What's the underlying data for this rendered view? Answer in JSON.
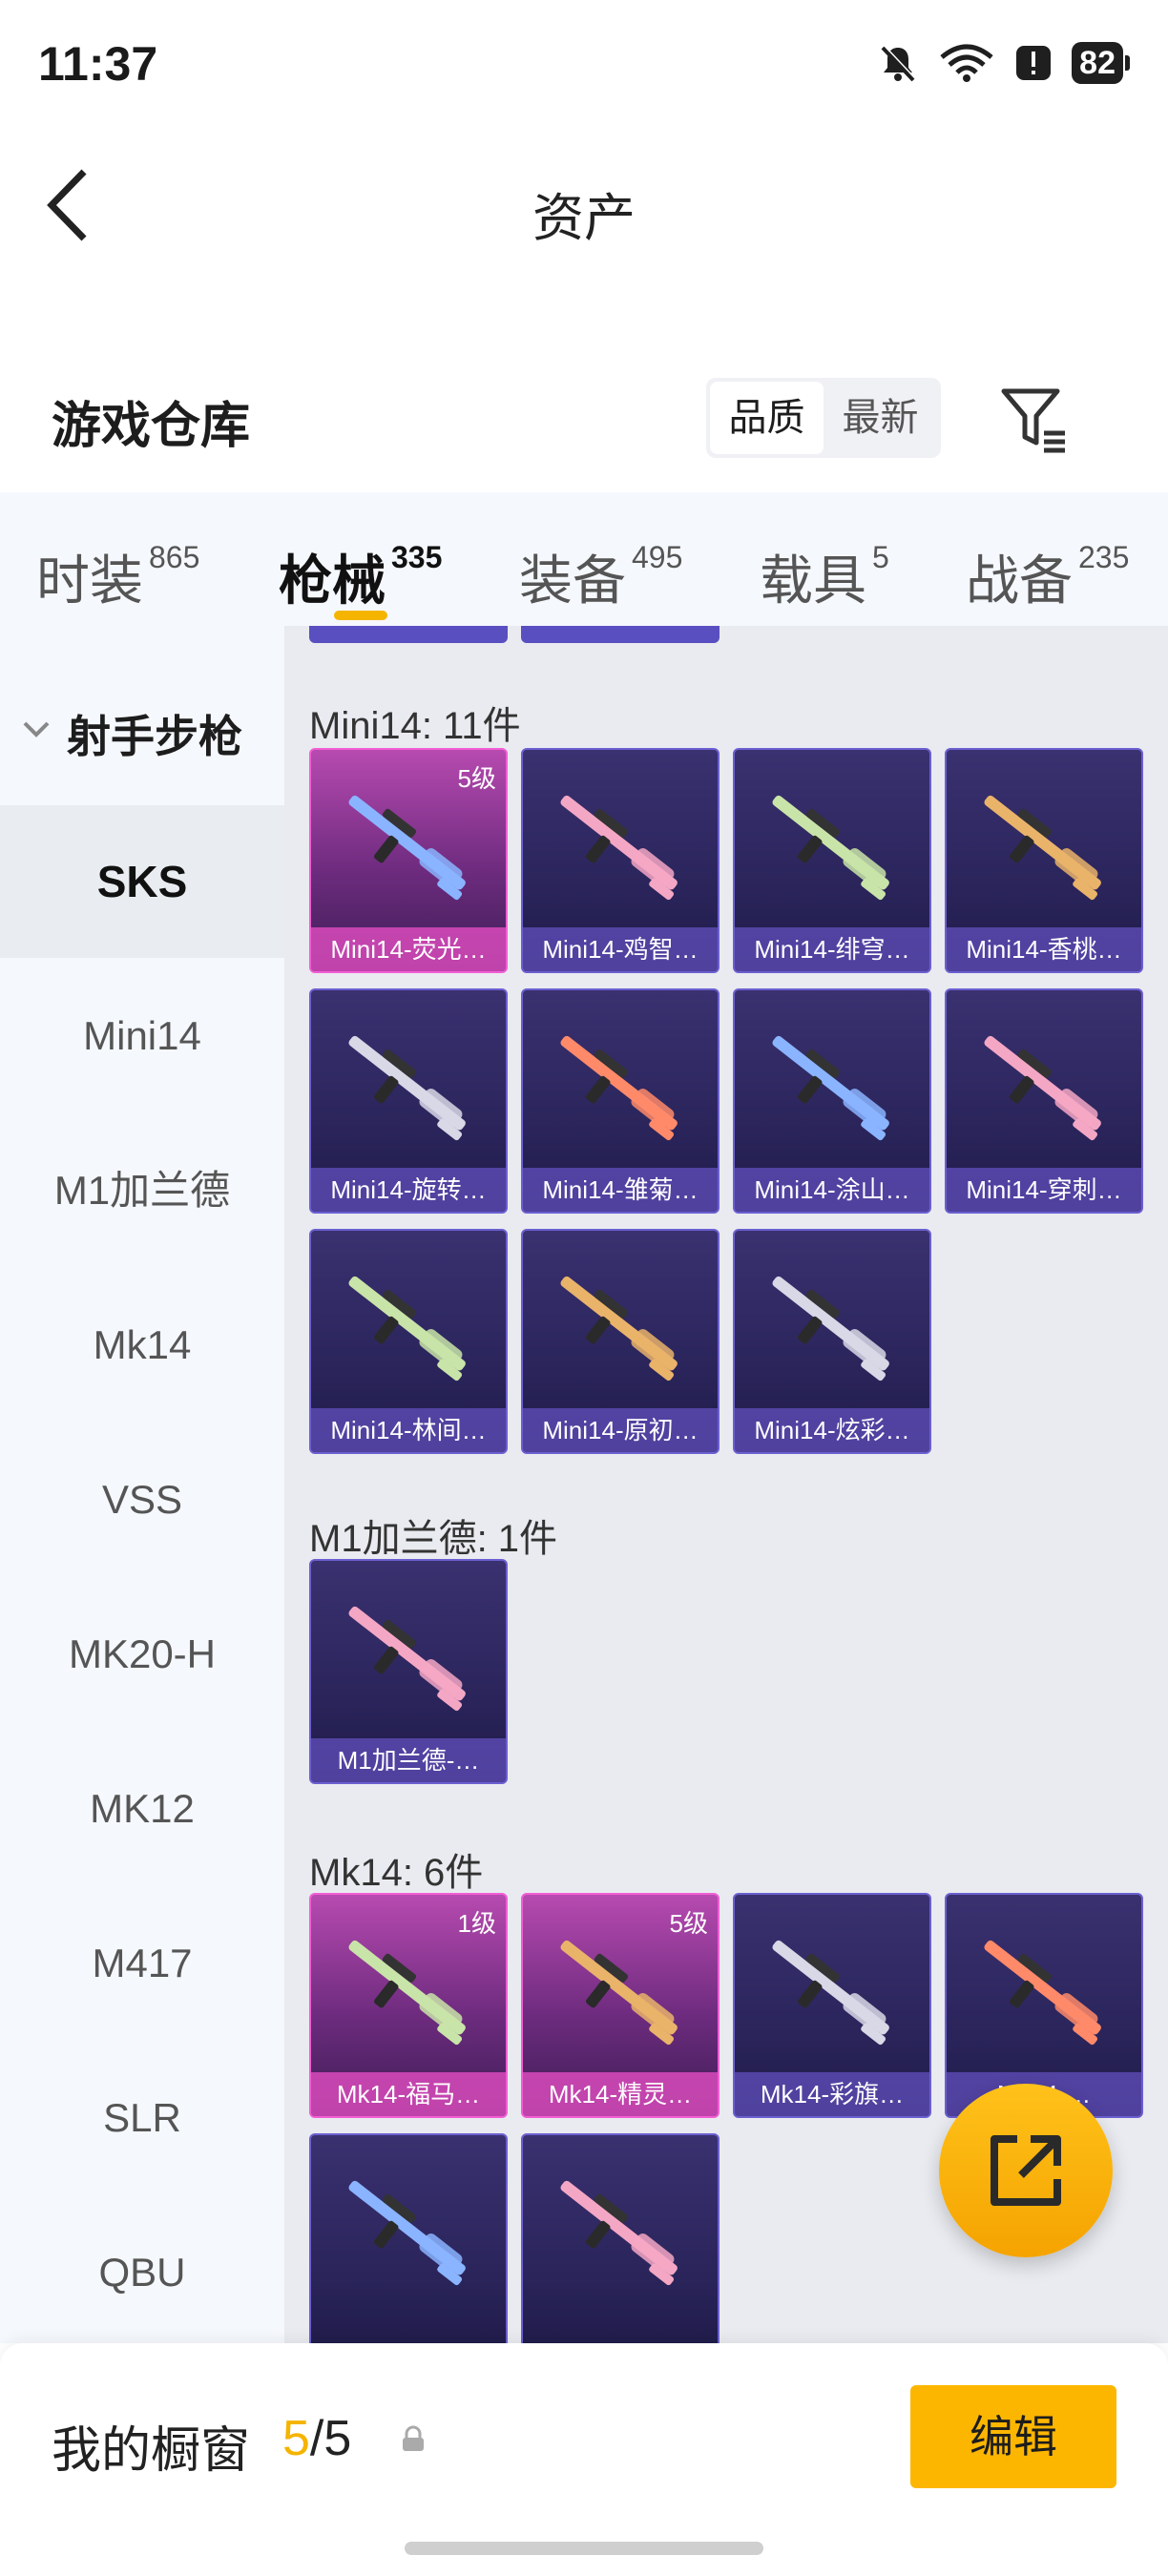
{
  "status_bar": {
    "time": "11:37",
    "battery": "82"
  },
  "header": {
    "title": "资产"
  },
  "warehouse": {
    "title": "游戏仓库",
    "sort_options": [
      "品质",
      "最新"
    ],
    "sort_selected": "品质"
  },
  "category_tabs": [
    {
      "label": "时装",
      "count": "865",
      "active": false
    },
    {
      "label": "枪械",
      "count": "335",
      "active": true
    },
    {
      "label": "装备",
      "count": "495",
      "active": false
    },
    {
      "label": "载具",
      "count": "5",
      "active": false
    },
    {
      "label": "战备",
      "count": "235",
      "active": false
    }
  ],
  "sidebar": {
    "group_label": "射手步枪",
    "items": [
      {
        "label": "SKS",
        "active": true
      },
      {
        "label": "Mini14",
        "active": false
      },
      {
        "label": "M1加兰德",
        "active": false
      },
      {
        "label": "Mk14",
        "active": false
      },
      {
        "label": "VSS",
        "active": false
      },
      {
        "label": "MK20-H",
        "active": false
      },
      {
        "label": "MK12",
        "active": false
      },
      {
        "label": "M417",
        "active": false
      },
      {
        "label": "SLR",
        "active": false
      },
      {
        "label": "QBU",
        "active": false
      }
    ]
  },
  "sections": [
    {
      "title": "Mini14: 11件",
      "cards": [
        {
          "name": "Mini14-荧光…",
          "level": "5级",
          "pink": true
        },
        {
          "name": "Mini14-鸡智…",
          "level": "",
          "pink": false
        },
        {
          "name": "Mini14-绯穹…",
          "level": "",
          "pink": false
        },
        {
          "name": "Mini14-香桃…",
          "level": "",
          "pink": false
        },
        {
          "name": "Mini14-旋转…",
          "level": "",
          "pink": false
        },
        {
          "name": "Mini14-雏菊…",
          "level": "",
          "pink": false
        },
        {
          "name": "Mini14-涂山…",
          "level": "",
          "pink": false
        },
        {
          "name": "Mini14-穿刺…",
          "level": "",
          "pink": false
        },
        {
          "name": "Mini14-林间…",
          "level": "",
          "pink": false
        },
        {
          "name": "Mini14-原初…",
          "level": "",
          "pink": false
        },
        {
          "name": "Mini14-炫彩…",
          "level": "",
          "pink": false
        }
      ]
    },
    {
      "title": "M1加兰德: 1件",
      "cards": [
        {
          "name": "M1加兰德-…",
          "level": "",
          "pink": false
        }
      ]
    },
    {
      "title": "Mk14: 6件",
      "cards": [
        {
          "name": "Mk14-福马…",
          "level": "1级",
          "pink": true
        },
        {
          "name": "Mk14-精灵…",
          "level": "5级",
          "pink": true
        },
        {
          "name": "Mk14-彩旗…",
          "level": "",
          "pink": false
        },
        {
          "name": "Mk14-…",
          "level": "",
          "pink": false
        },
        {
          "name": "",
          "level": "",
          "pink": false
        },
        {
          "name": "",
          "level": "",
          "pink": false
        }
      ]
    }
  ],
  "bottom_bar": {
    "label": "我的橱窗",
    "count_current": "5",
    "count_separator": "/",
    "count_total": "5",
    "edit_label": "编辑"
  },
  "colors": {
    "accent": "#f5b400",
    "card_blue": "#2b255c",
    "card_pink": "#b74ab0"
  }
}
